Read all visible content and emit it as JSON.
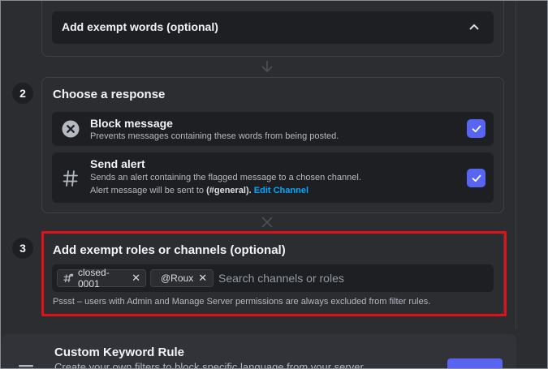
{
  "step1": {
    "exempt_words_label": "Add exempt words (optional)",
    "chevron_icon": "chevron-up-icon"
  },
  "step2": {
    "number": "2",
    "title": "Choose a response",
    "block": {
      "title": "Block message",
      "desc": "Prevents messages containing these words from being posted.",
      "icon": "x-circle-icon"
    },
    "alert": {
      "title": "Send alert",
      "desc": "Sends an alert containing the flagged message to a chosen channel.",
      "desc2_prefix": "Alert message will be sent to ",
      "channel": "(#general).",
      "edit_link": "Edit Channel",
      "icon": "hashtag-icon"
    }
  },
  "step3": {
    "number": "3",
    "title": "Add exempt roles or channels (optional)",
    "chips": [
      {
        "label": "closed-0001"
      },
      {
        "label": "@Roux"
      }
    ],
    "search_placeholder": "Search channels or roles",
    "hint": "Pssst – users with Admin and Manage Server permissions are always excluded from filter rules."
  },
  "custom_rule": {
    "title": "Custom Keyword Rule",
    "desc": "Create your own filters to block specific language from your server."
  },
  "colors": {
    "accent": "#5865f2",
    "link": "#00a8fc",
    "highlight": "#e0111b",
    "background": "#2b2d31"
  }
}
